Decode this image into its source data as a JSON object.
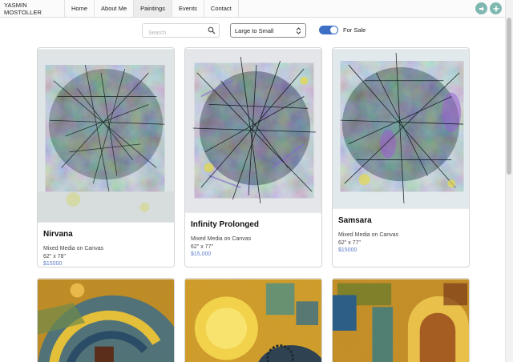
{
  "nav": {
    "brand": "YASMIN MOSTOLLER",
    "items": [
      {
        "label": "Home"
      },
      {
        "label": "About Me"
      },
      {
        "label": "Paintings"
      },
      {
        "label": "Events"
      },
      {
        "label": "Contact"
      }
    ],
    "active": "Paintings",
    "icons": [
      "share-icon",
      "plus-icon"
    ],
    "accent": "#7fb8b0"
  },
  "filters": {
    "search_placeholder": "Search",
    "sort_value": "Large to Small",
    "for_sale_label": "For Sale",
    "for_sale_on": true,
    "toggle_color": "#3d6fc4"
  },
  "paintings": [
    {
      "title": "Nirvana",
      "medium": "Mixed Media on Canvas",
      "dimensions": "62\" x 78\"",
      "price": "$15000"
    },
    {
      "title": "Infinity Prolonged",
      "medium": "Mixed Media on Canvas",
      "dimensions": "62\" x 77\"",
      "price": "$15,000"
    },
    {
      "title": "Samsara",
      "medium": "Mixed Media on Canvas",
      "dimensions": "62\" x 77\"",
      "price": "$15000"
    }
  ],
  "price_color": "#5c7dc9"
}
